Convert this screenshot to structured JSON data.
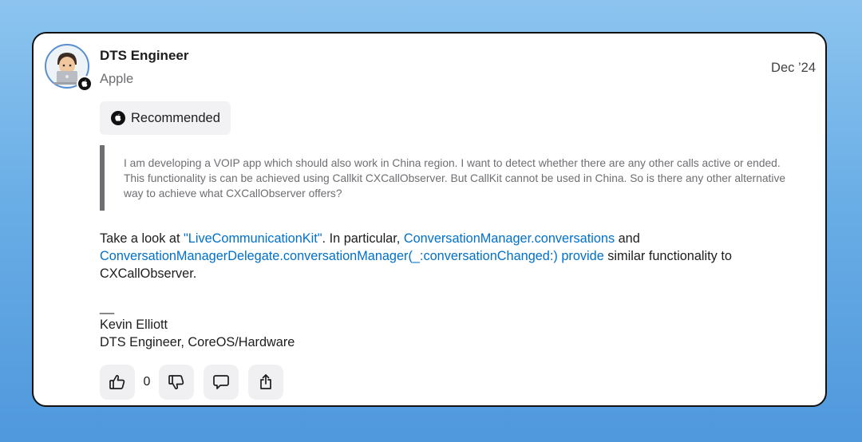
{
  "post": {
    "author_name": "DTS Engineer",
    "author_org": "Apple",
    "date": "Dec ’24",
    "badge_label": "Recommended",
    "quote": "I am developing a VOIP app which should also work in China region. I want to detect whether there are any other calls active or ended. This functionality is can be achieved using Callkit CXCallObserver. But CallKit cannot be used in China. So is there any other alternative way to achieve what CXCallObserver offers?",
    "answer": {
      "text_1": "Take a look at ",
      "link_1": "\"LiveCommunicationKit\"",
      "text_2": ". In particular, ",
      "link_2": "ConversationManager.conversations",
      "text_3": " and ",
      "link_3": "ConversationManagerDelegate.conversationManager(_:conversationChanged:)",
      "text_4": " ",
      "link_4": "provide",
      "text_5": " similar functionality to CXCallObserver."
    },
    "signature": {
      "dash": "__",
      "name": "Kevin Elliott",
      "title": "DTS Engineer, CoreOS/Hardware"
    },
    "actions": {
      "vote_count": "0"
    }
  },
  "icons": {
    "avatar": "developer-avatar-icon",
    "apple": "apple-logo-icon",
    "like": "thumbs-up-icon",
    "dislike": "thumbs-down-icon",
    "comment": "comment-icon",
    "share": "share-icon"
  },
  "colors": {
    "link": "#0070c9",
    "background_top": "#8cc4ef",
    "background_bottom": "#4f98dc"
  }
}
